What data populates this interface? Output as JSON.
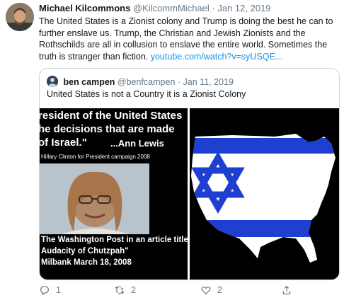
{
  "tweet": {
    "name": "Michael Kilcommons",
    "handle": "@KilcommMichael",
    "dot": "·",
    "date": "Jan 12, 2019",
    "text": "The United States is a Zionist colony and Trump is doing the best he can to further enslave us. Trump, the Christian and Jewish Zionists and the Rothschilds are all in collusion to enslave the entire world. Sometimes the truth is stranger than fiction.",
    "link": "youtube.com/watch?v=syUSQE..."
  },
  "quote": {
    "name": "ben campen",
    "handle": "@benfcampen",
    "dot": "·",
    "date": "Jan 11, 2019",
    "text": "United States is not a Country it is a Zionist Colony",
    "left_image": {
      "line1": "resident of the United States",
      "line2": "he decisions that are made",
      "line3": "of Israel.\"",
      "line3b": "...Ann Lewis",
      "line4": "Hillary Clinton for President campaign 2008",
      "line5": "The Washington Post in an article titled:",
      "line6": "Audacity of Chutzpah\"",
      "line7": "Milbank  March 18, 2008"
    }
  },
  "actions": {
    "reply_count": "1",
    "retweet_count": "2",
    "like_count": "2"
  },
  "colors": {
    "link": "#1b95e0",
    "muted": "#657786",
    "flag_blue": "#1e3fd0"
  }
}
